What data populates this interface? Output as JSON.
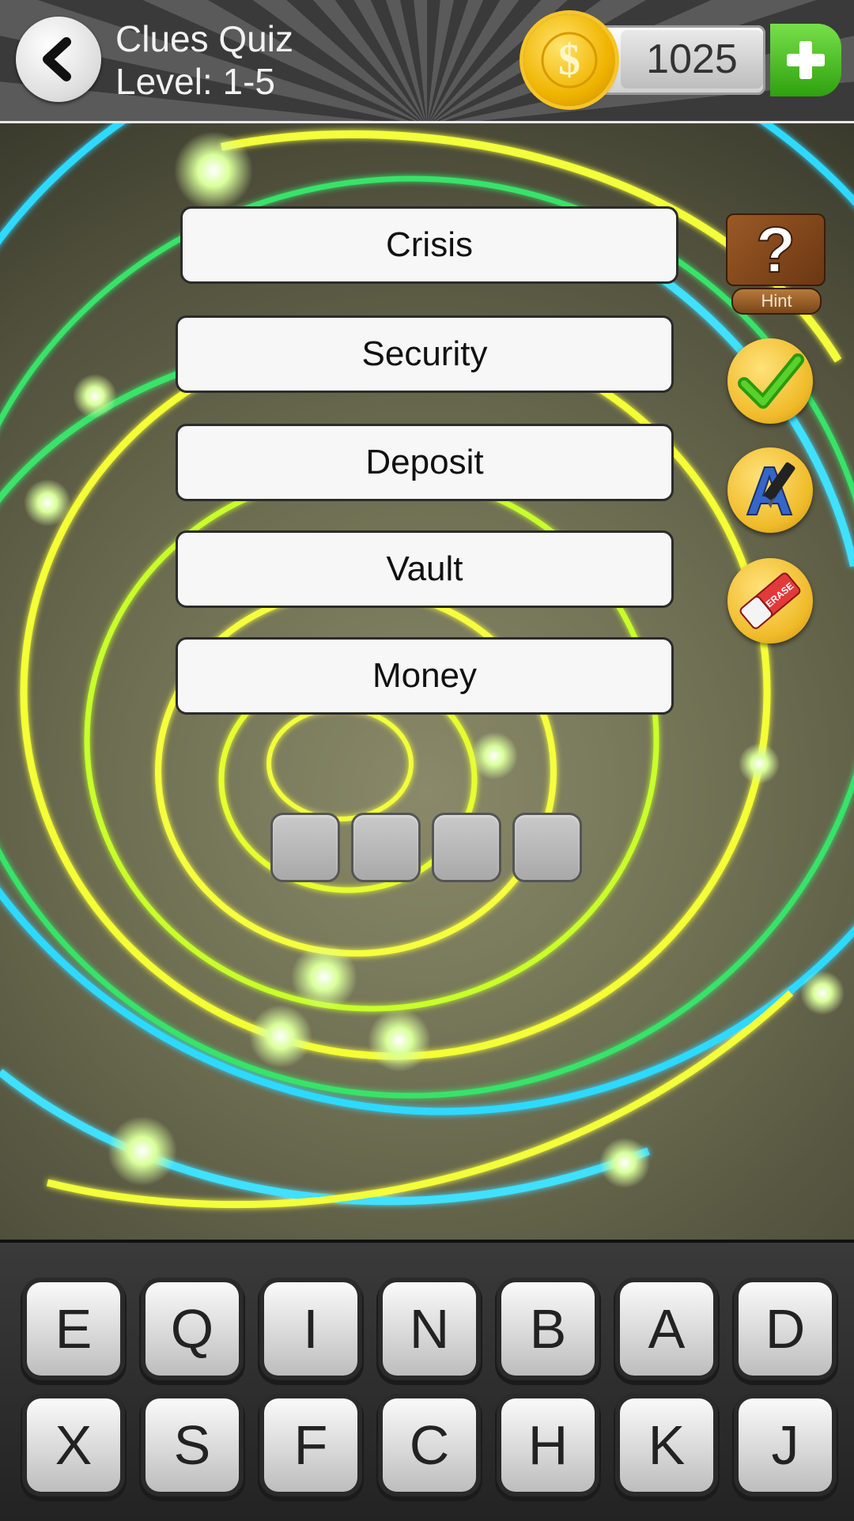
{
  "header": {
    "game_title": "Clues Quiz",
    "level_label": "Level: 1-5",
    "coins": "1025"
  },
  "icons": {
    "back": "chevron-left-icon",
    "coin": "dollar-coin-icon",
    "add": "plus-icon",
    "hint": "question-mark-icon",
    "check": "checkmark-icon",
    "reveal": "letter-pen-icon",
    "erase": "eraser-icon"
  },
  "side_buttons": {
    "hint_label": "Hint",
    "eraser_text": "ERASE"
  },
  "clues": [
    "Crisis",
    "Security",
    "Deposit",
    "Vault",
    "Money"
  ],
  "answer_slots": 4,
  "keyboard": {
    "row1": [
      "E",
      "Q",
      "I",
      "N",
      "B",
      "A",
      "D"
    ],
    "row2": [
      "X",
      "S",
      "F",
      "C",
      "H",
      "K",
      "J"
    ]
  },
  "colors": {
    "accent_green": "#3fbf1a",
    "coin_gold": "#f0b400"
  }
}
